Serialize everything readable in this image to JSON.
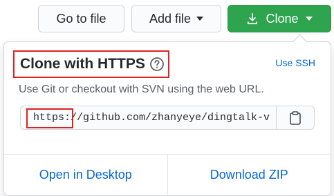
{
  "toolbar": {
    "go_to_file_label": "Go to file",
    "add_file_label": "Add file",
    "clone_label": "Clone"
  },
  "clone_popover": {
    "title": "Clone with HTTPS",
    "use_ssh_label": "Use SSH",
    "description": "Use Git or checkout with SVN using the web URL.",
    "url_value": "https://github.com/zhanyeye/dingtalk-v",
    "open_desktop_label": "Open in Desktop",
    "download_zip_label": "Download ZIP"
  },
  "icons": {
    "clone_button": "download-icon",
    "title_help": "help-icon",
    "copy": "clipboard-icon",
    "dropdowns": "chevron-down-icon"
  },
  "colors": {
    "clone_button_bg": "#2ea44f",
    "link": "#0366d6",
    "highlight": "#e02020",
    "border": "#d1d5da"
  }
}
